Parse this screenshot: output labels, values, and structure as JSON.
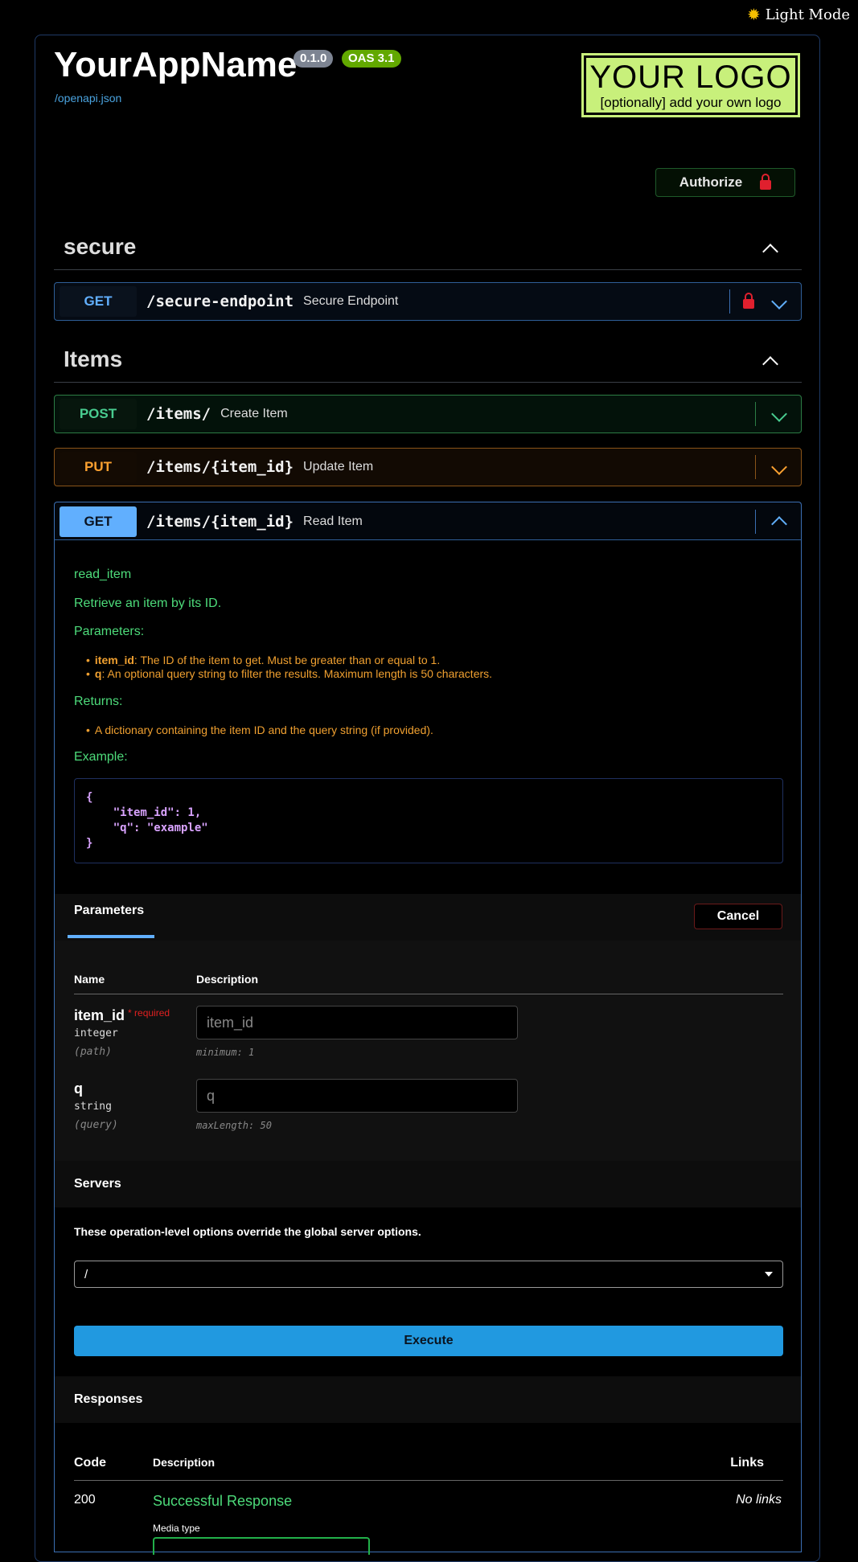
{
  "theme_toggle": {
    "label": "Light Mode",
    "icon": "sun-icon"
  },
  "header": {
    "title": "YourAppName",
    "version": "0.1.0",
    "oas": "OAS 3.1",
    "spec_link": "/openapi.json",
    "logo_main": "YOUR LOGO",
    "logo_sub": "[optionally] add your own logo"
  },
  "authorize_label": "Authorize",
  "sections": [
    {
      "name": "secure",
      "operations": [
        {
          "method": "GET",
          "path": "/secure-endpoint",
          "summary": "Secure Endpoint"
        }
      ]
    },
    {
      "name": "Items",
      "operations": [
        {
          "method": "POST",
          "path": "/items/",
          "summary": "Create Item"
        },
        {
          "method": "PUT",
          "path": "/items/{item_id}",
          "summary": "Update Item"
        },
        {
          "method": "GET",
          "path": "/items/{item_id}",
          "summary": "Read Item"
        }
      ]
    }
  ],
  "read_item": {
    "doc_title": "read_item",
    "doc_desc": "Retrieve an item by its ID.",
    "params_heading": "Parameters:",
    "param_docs": [
      {
        "name": "item_id",
        "text": ": The ID of the item to get. Must be greater than or equal to 1."
      },
      {
        "name": "q",
        "text": ": An optional query string to filter the results. Maximum length is 50 characters."
      }
    ],
    "returns_heading": "Returns:",
    "returns_item": "A dictionary containing the item ID and the query string (if provided).",
    "example_heading": "Example:",
    "example_code": "{\n    \"item_id\": 1,\n    \"q\": \"example\"\n}",
    "params_tab": "Parameters",
    "cancel_label": "Cancel",
    "col_name": "Name",
    "col_description": "Description",
    "params": [
      {
        "name": "item_id",
        "required": "* required",
        "type": "integer",
        "in": "(path)",
        "placeholder": "item_id",
        "constraint": "minimum: 1"
      },
      {
        "name": "q",
        "required": "",
        "type": "string",
        "in": "(query)",
        "placeholder": "q",
        "constraint": "maxLength: 50"
      }
    ],
    "servers_title": "Servers",
    "servers_note": "These operation-level options override the global server options.",
    "server_selected": "/",
    "execute_label": "Execute",
    "responses_title": "Responses",
    "resp_col_code": "Code",
    "resp_col_description": "Description",
    "resp_col_links": "Links",
    "response": {
      "code": "200",
      "description": "Successful Response",
      "links": "No links"
    },
    "media_type_label": "Media type"
  }
}
